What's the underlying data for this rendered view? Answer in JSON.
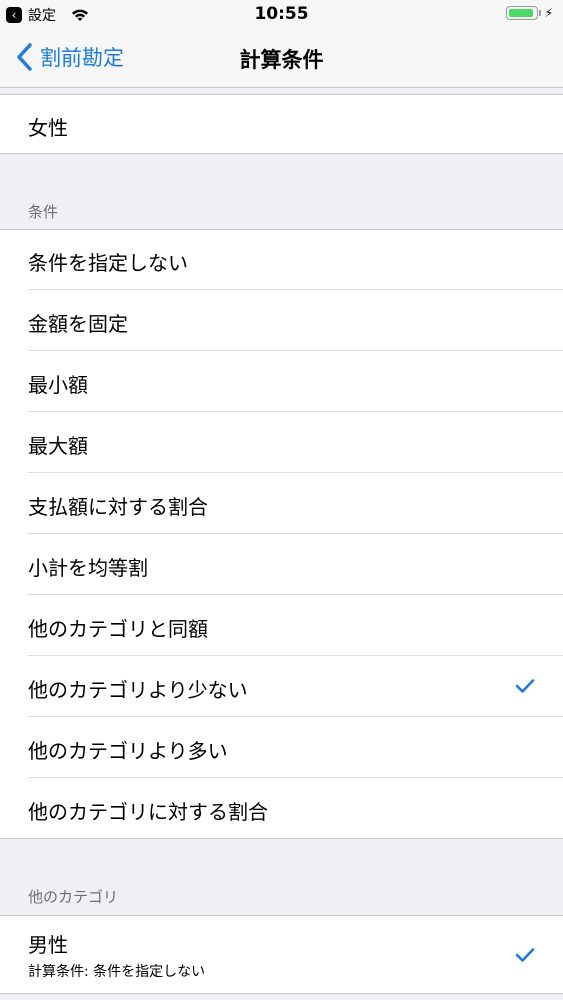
{
  "status_bar": {
    "back_app": "設定",
    "time": "10:55"
  },
  "nav": {
    "back_label": "割前勘定",
    "title": "計算条件"
  },
  "top_cell": {
    "label": "女性"
  },
  "conditions_section": {
    "header": "条件",
    "items": [
      {
        "label": "条件を指定しない",
        "checked": false
      },
      {
        "label": "金額を固定",
        "checked": false
      },
      {
        "label": "最小額",
        "checked": false
      },
      {
        "label": "最大額",
        "checked": false
      },
      {
        "label": "支払額に対する割合",
        "checked": false
      },
      {
        "label": "小計を均等割",
        "checked": false
      },
      {
        "label": "他のカテゴリと同額",
        "checked": false
      },
      {
        "label": "他のカテゴリより少ない",
        "checked": true
      },
      {
        "label": "他のカテゴリより多い",
        "checked": false
      },
      {
        "label": "他のカテゴリに対する割合",
        "checked": false
      }
    ]
  },
  "other_category_section": {
    "header": "他のカテゴリ",
    "item": {
      "label": "男性",
      "subtitle": "計算条件: 条件を指定しない",
      "checked": true
    }
  },
  "colors": {
    "accent": "#1a7ce2",
    "background": "#efeff4",
    "battery": "#4cd964"
  }
}
